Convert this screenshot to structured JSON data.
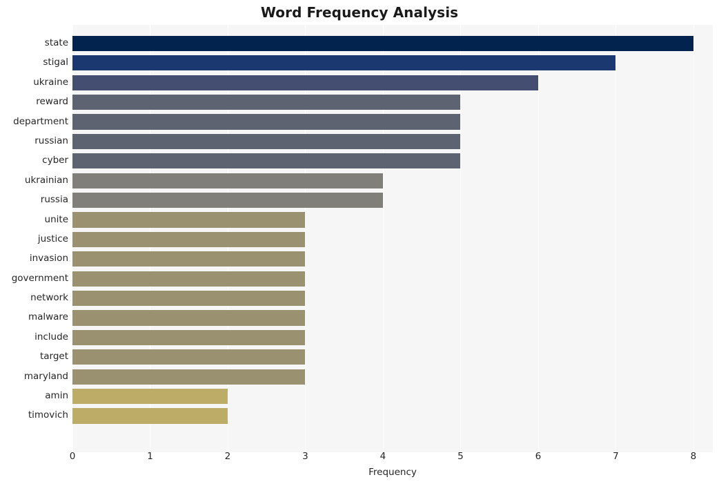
{
  "chart_data": {
    "type": "bar",
    "orientation": "horizontal",
    "title": "Word Frequency Analysis",
    "xlabel": "Frequency",
    "ylabel": "",
    "xlim": [
      0,
      8.25
    ],
    "xticks": [
      "0",
      "1",
      "2",
      "3",
      "4",
      "5",
      "6",
      "7",
      "8"
    ],
    "xtick_values": [
      0,
      1,
      2,
      3,
      4,
      5,
      6,
      7,
      8
    ],
    "grid": "vertical",
    "legend": "none",
    "categories": [
      "state",
      "stigal",
      "ukraine",
      "reward",
      "department",
      "russian",
      "cyber",
      "ukrainian",
      "russia",
      "unite",
      "justice",
      "invasion",
      "government",
      "network",
      "malware",
      "include",
      "target",
      "maryland",
      "amin",
      "timovich"
    ],
    "values": [
      8,
      7,
      6,
      5,
      5,
      5,
      5,
      4,
      4,
      3,
      3,
      3,
      3,
      3,
      3,
      3,
      3,
      3,
      2,
      2
    ],
    "bar_colors": [
      "#01234d",
      "#1b3870",
      "#434e70",
      "#5d6370",
      "#5d6370",
      "#5d6370",
      "#5d6370",
      "#807f79",
      "#807f79",
      "#999170",
      "#999170",
      "#999170",
      "#999170",
      "#999170",
      "#999170",
      "#999170",
      "#999170",
      "#999170",
      "#bcac68",
      "#bcac68"
    ],
    "plot_background": "#f6f6f7",
    "gridline_color": "#ffffff",
    "figure_background": "#ffffff",
    "text_color": "#262626"
  }
}
